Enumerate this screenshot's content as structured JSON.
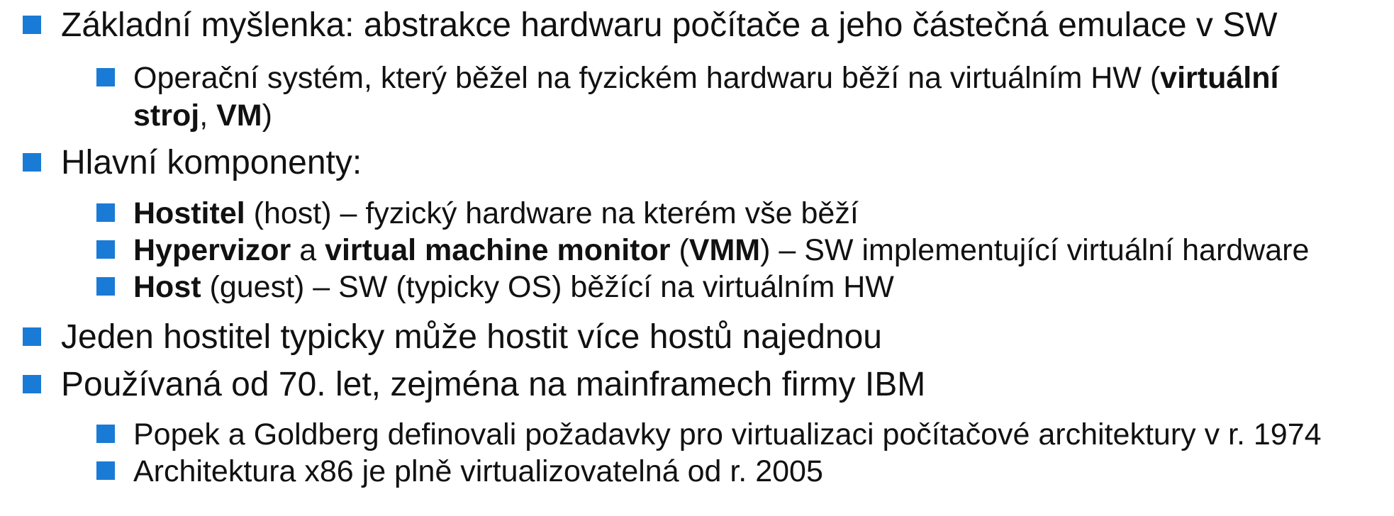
{
  "bullet_color": "#1a7bd6",
  "items": [
    {
      "level": 1,
      "parts": [
        {
          "t": "Základní myšlenka: abstrakce hardwaru počítače a jeho částečná emulace v SW",
          "b": false
        }
      ]
    },
    {
      "level": 2,
      "parts": [
        {
          "t": "Operační systém, který běžel na fyzickém hardwaru běží na virtuálním HW (",
          "b": false
        },
        {
          "t": "virtuální",
          "b": true
        }
      ]
    },
    {
      "level": 2,
      "continuation": true,
      "parts": [
        {
          "t": "stroj",
          "b": true
        },
        {
          "t": ", ",
          "b": false
        },
        {
          "t": "VM",
          "b": true
        },
        {
          "t": ")",
          "b": false
        }
      ]
    },
    {
      "level": 1,
      "parts": [
        {
          "t": "Hlavní komponenty:",
          "b": false
        }
      ]
    },
    {
      "level": 2,
      "parts": [
        {
          "t": "Hostitel",
          "b": true
        },
        {
          "t": " (host) – fyzický hardware na kterém vše běží",
          "b": false
        }
      ]
    },
    {
      "level": 2,
      "parts": [
        {
          "t": "Hypervizor",
          "b": true
        },
        {
          "t": " a ",
          "b": false
        },
        {
          "t": "virtual machine monitor",
          "b": true
        },
        {
          "t": " (",
          "b": false
        },
        {
          "t": "VMM",
          "b": true
        },
        {
          "t": ") – SW implementující virtuální hardware",
          "b": false
        }
      ]
    },
    {
      "level": 2,
      "parts": [
        {
          "t": "Host",
          "b": true
        },
        {
          "t": " (guest) – SW (typicky OS) běžící na virtuálním HW",
          "b": false
        }
      ]
    },
    {
      "level": 1,
      "parts": [
        {
          "t": "Jeden hostitel typicky může hostit více hostů najednou",
          "b": false
        }
      ]
    },
    {
      "level": 1,
      "parts": [
        {
          "t": "Používaná od 70. let, zejména na mainframech firmy IBM",
          "b": false
        }
      ]
    },
    {
      "level": 2,
      "parts": [
        {
          "t": "Popek a Goldberg definovali požadavky pro virtualizaci počítačové architektury v r. 1974",
          "b": false
        }
      ]
    },
    {
      "level": 2,
      "parts": [
        {
          "t": "Architektura x86 je plně virtualizovatelná od r. 2005",
          "b": false
        }
      ]
    }
  ]
}
